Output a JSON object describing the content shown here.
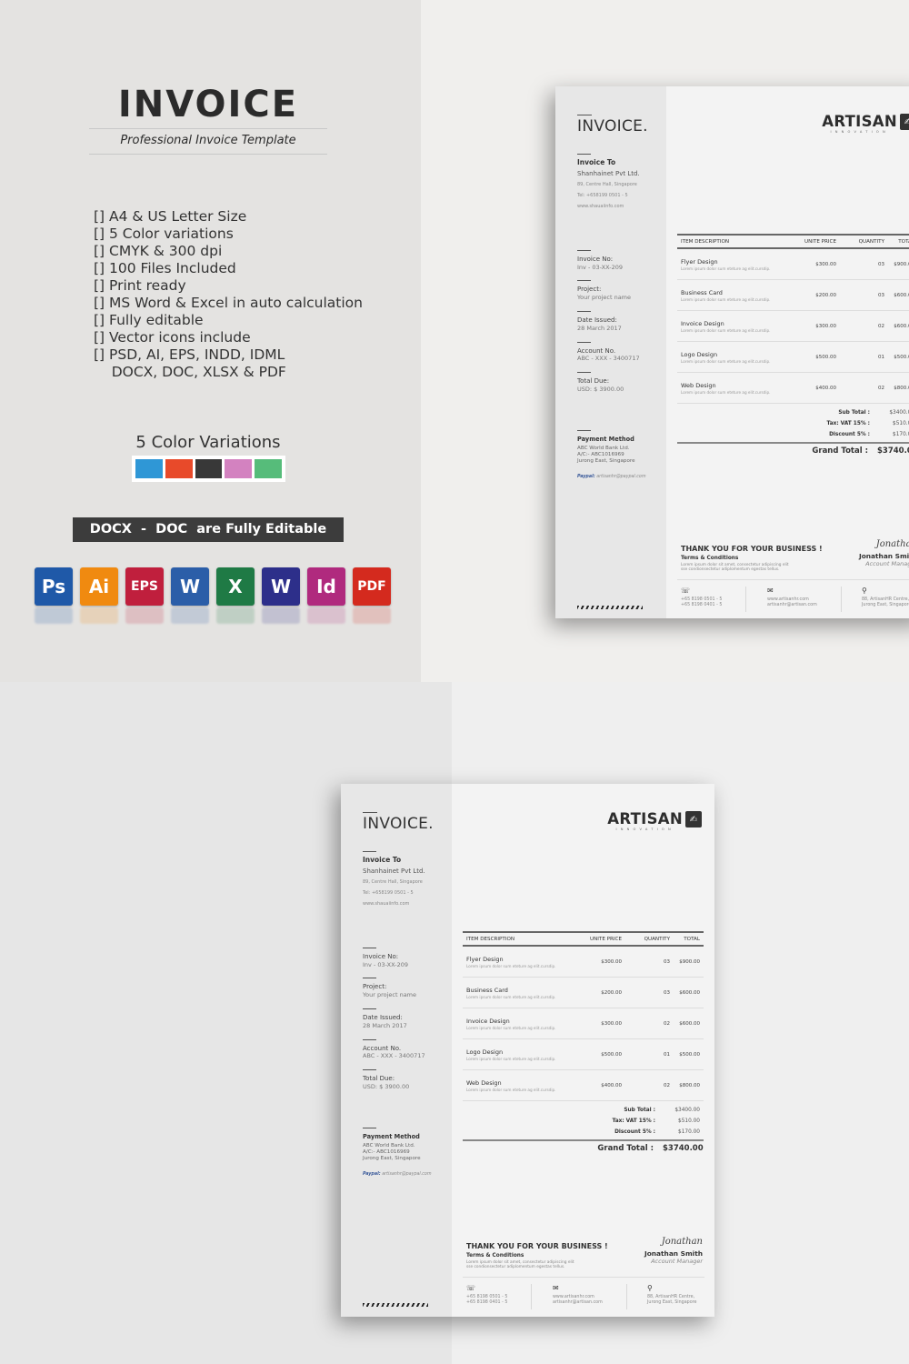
{
  "promo": {
    "title": "INVOICE",
    "subtitle": "Professional Invoice Template",
    "features": [
      "[] A4 & US Letter Size",
      "[] 5 Color variations",
      "[] CMYK & 300 dpi",
      "[] 100 Files Included",
      "[] Print ready",
      "[] MS Word & Excel in auto calculation",
      "[] Fully editable",
      "[] Vector icons include",
      "[] PSD, AI, EPS, INDD, IDML",
      "    DOCX, DOC, XLSX & PDF"
    ],
    "colors_title": "5 Color Variations",
    "swatches": [
      "#2f97d6",
      "#e84a2a",
      "#383838",
      "#d382c0",
      "#56bc7a"
    ],
    "editable_banner": "DOCX  -  DOC  are Fully Editable",
    "apps": [
      {
        "label": "Ps",
        "icon": "photoshop-icon",
        "color": "#1f59a8"
      },
      {
        "label": "Ai",
        "icon": "illustrator-icon",
        "color": "#f08a10"
      },
      {
        "label": "EPS",
        "icon": "eps-icon",
        "color": "#c01f3d"
      },
      {
        "label": "W",
        "icon": "word-icon",
        "color": "#2b5ea8"
      },
      {
        "label": "X",
        "icon": "excel-icon",
        "color": "#1f7a45"
      },
      {
        "label": "W",
        "icon": "wordperfect-icon",
        "color": "#2d2f8a"
      },
      {
        "label": "Id",
        "icon": "indesign-icon",
        "color": "#b02a7e"
      },
      {
        "label": "PDF",
        "icon": "pdf-icon",
        "color": "#d42a1e"
      }
    ]
  },
  "invoice": {
    "heading": "INVOICE.",
    "brand_name": "ARTISAN",
    "brand_tagline": "INNOVATION",
    "invoice_to_label": "Invoice To",
    "client_name": "Shanhainet Pvt Ltd.",
    "client_address": "89, Centre Hall, Singapore",
    "client_tel": "Tel: +658199 0501 - 5",
    "client_web": "www.shauaiinfo.com",
    "meta": [
      {
        "label": "Invoice No:",
        "value": "Inv - 03-XX-209"
      },
      {
        "label": "Project:",
        "value": "Your project name"
      },
      {
        "label": "Date Issued:",
        "value": "28  March  2017"
      },
      {
        "label": "Account No.",
        "value": "ABC - XXX - 3400717"
      },
      {
        "label": "Total Due:",
        "value": "USD:   $ 3900.00"
      }
    ],
    "payment_label": "Payment Method",
    "payment_lines": [
      "ABC World Bank Ltd.",
      "A/C:-  ABC1016969",
      "Jurong East, Singapore"
    ],
    "paypal_label": "Paypal:",
    "paypal_value": "artisanhr@paypal.com",
    "columns": [
      "ITEM DESCRIPTION",
      "UNITE PRICE",
      "QUANTITY",
      "TOTAL"
    ],
    "items": [
      {
        "name": "Flyer Design",
        "desc": "Lorem ipsum dolor sum eteture ag elit.cursdip.",
        "price": "$300.00",
        "qty": "03",
        "total": "$900.00"
      },
      {
        "name": "Business Card",
        "desc": "Lorem ipsum dolor sum eteture ag elit.cursdip.",
        "price": "$200.00",
        "qty": "03",
        "total": "$600.00"
      },
      {
        "name": "Invoice Design",
        "desc": "Lorem ipsum dolor sum eteture ag elit.cursdip.",
        "price": "$300.00",
        "qty": "02",
        "total": "$600.00"
      },
      {
        "name": "Logo Design",
        "desc": "Lorem ipsum dolor sum eteture ag elit.cursdip.",
        "price": "$500.00",
        "qty": "01",
        "total": "$500.00"
      },
      {
        "name": "Web Design",
        "desc": "Lorem ipsum dolor sum eteture ag elit.cursdip.",
        "price": "$400.00",
        "qty": "02",
        "total": "$800.00"
      }
    ],
    "summary": [
      {
        "label": "Sub Total  :",
        "value": "$3400.00"
      },
      {
        "label": "Tax: VAT 15%  :",
        "value": "$510.00"
      },
      {
        "label": "Discount 5%  :",
        "value": "$170.00"
      }
    ],
    "grand_total_label": "Grand Total  :",
    "grand_total_value": "$3740.00",
    "thanks": "THANK YOU FOR YOUR BUSINESS !",
    "terms_label": "Terms & Conditions",
    "terms_text_1": "Lorem ipsum dolor sit amet, consectetur adipiscing elit",
    "terms_text_2": "sse  condionsectetur adiplomentum egestas tellus.",
    "signature_scrawl": "Jonathan",
    "signer_name": "Jonathan Smith",
    "signer_role": "Account Manager",
    "phone_1": "+65 8198 0501 - 5",
    "phone_2": "+65 8198 0401 - 5",
    "web_1": "www.artisanhr.com",
    "web_2": "artisanhr@artisan.com",
    "addr_1": "88, ArtisanHR Centre,",
    "addr_2": "Jurong East, Singapore",
    "icons": {
      "phone": "☏",
      "mail": "✉",
      "location": "⚲",
      "brand_mark": "✍"
    }
  }
}
